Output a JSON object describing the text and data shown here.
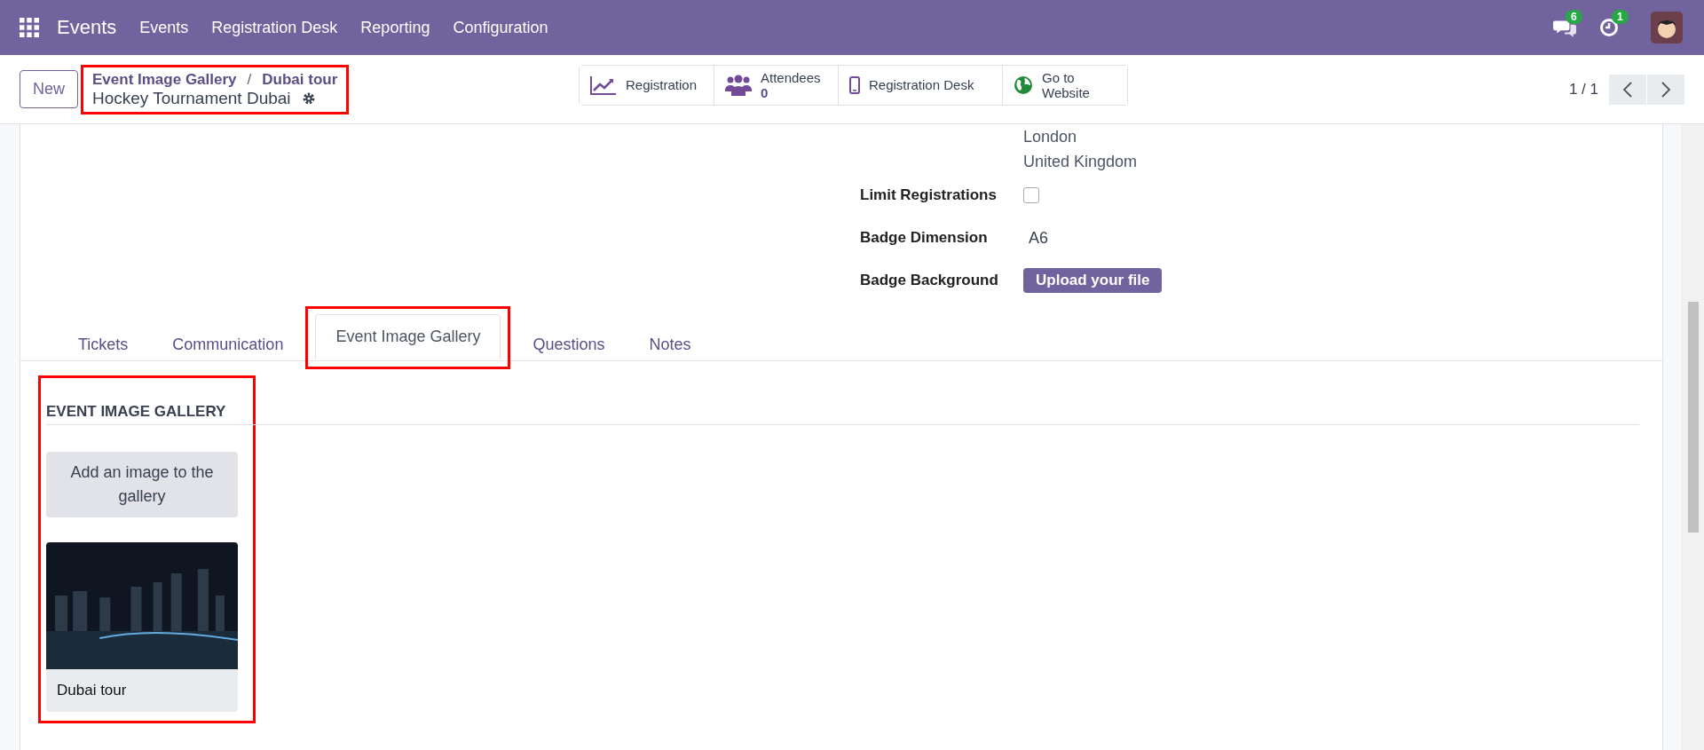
{
  "navbar": {
    "app_name": "Events",
    "menu": [
      "Events",
      "Registration Desk",
      "Reporting",
      "Configuration"
    ],
    "messages_count": "6",
    "activities_count": "1"
  },
  "control_panel": {
    "new_button": "New",
    "breadcrumb_highlighted": true,
    "breadcrumbs": [
      "Event Image Gallery",
      "Dubai tour"
    ],
    "breadcrumb_separator": "/",
    "record_title": "Hockey Tournament Dubai",
    "smart_buttons": [
      {
        "kind": "chart",
        "label": "Registration"
      },
      {
        "kind": "users",
        "label": "Attendees",
        "value": "0"
      },
      {
        "kind": "phone",
        "label": "Registration Desk"
      },
      {
        "kind": "globe",
        "label": "Go to Website"
      }
    ],
    "pager": "1 / 1"
  },
  "form": {
    "address_lines": [
      "London",
      "United Kingdom"
    ],
    "fields": [
      {
        "kind": "checkbox",
        "label": "Limit Registrations",
        "checked": false
      },
      {
        "kind": "text",
        "label": "Badge Dimension",
        "value": "A6"
      },
      {
        "kind": "upload",
        "label": "Badge Background",
        "button": "Upload your file"
      }
    ]
  },
  "tabs": [
    {
      "label": "Tickets",
      "selected": false,
      "highlighted": false
    },
    {
      "label": "Communication",
      "selected": false,
      "highlighted": false
    },
    {
      "label": "Event Image Gallery",
      "selected": true,
      "highlighted": true
    },
    {
      "label": "Questions",
      "selected": false,
      "highlighted": false
    },
    {
      "label": "Notes",
      "selected": false,
      "highlighted": false
    }
  ],
  "gallery": {
    "highlighted": true,
    "title": "EVENT IMAGE GALLERY",
    "add_button": "Add an image to the gallery",
    "images": [
      {
        "caption": "Dubai tour"
      }
    ]
  }
}
